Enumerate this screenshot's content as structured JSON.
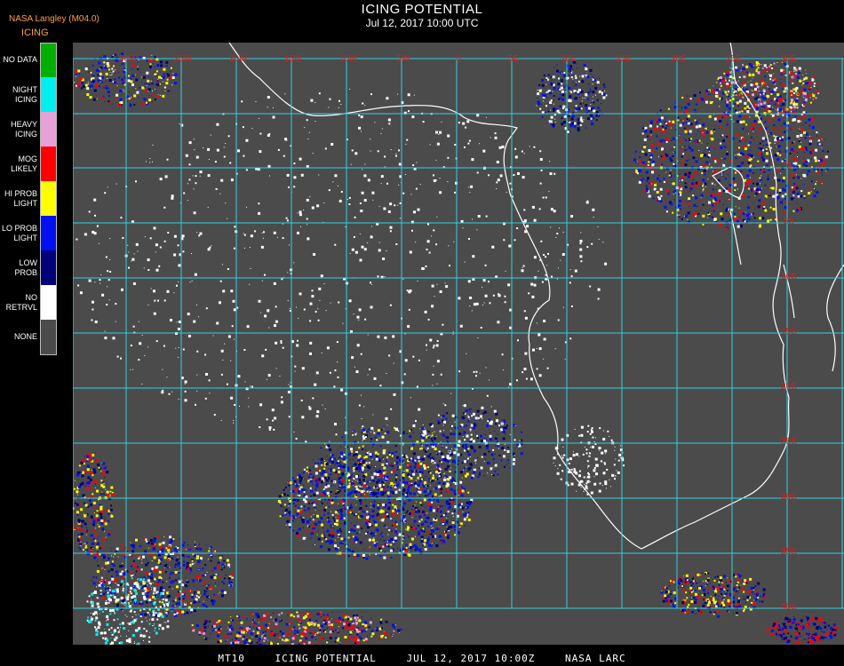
{
  "header": {
    "source": "NASA Langley (M04.0)",
    "product_short": "ICING",
    "title": "ICING POTENTIAL",
    "datetime": "Jul 12, 2017 10:00 UTC"
  },
  "legend": [
    {
      "label": "NO DATA",
      "color": "#00b000"
    },
    {
      "label": "NIGHT\nICING",
      "color": "#00f0f0"
    },
    {
      "label": "HEAVY\nICING",
      "color": "#e8a0d8"
    },
    {
      "label": "MOG\nLIKELY",
      "color": "#ff0000"
    },
    {
      "label": "HI PROB\nLIGHT",
      "color": "#ffff00"
    },
    {
      "label": "LO PROB\nLIGHT",
      "color": "#0010f0"
    },
    {
      "label": "LOW\nPROB",
      "color": "#000078"
    },
    {
      "label": "NO\nRETRVL",
      "color": "#ffffff"
    },
    {
      "label": "NONE",
      "color": "#4b4b4b"
    }
  ],
  "map": {
    "background": "#4b4b4b",
    "grid_color": "#30d0e0",
    "coast_color": "#ffffff",
    "lon_labels": [
      "30W",
      "25W",
      "20W",
      "15W",
      "10W",
      "5W",
      "0",
      "5E",
      "10E",
      "15E",
      "20E",
      "25E",
      "30E"
    ],
    "lat_labels": [
      "5N",
      "0",
      "5S",
      "10S",
      "15S",
      "20S",
      "25S",
      "30S",
      "35S",
      "40S"
    ],
    "label_color": "#d02020"
  },
  "footer": {
    "code": "MT10",
    "product": "ICING POTENTIAL",
    "date": "JUL 12, 2017 10:00Z",
    "org": "NASA LARC"
  }
}
